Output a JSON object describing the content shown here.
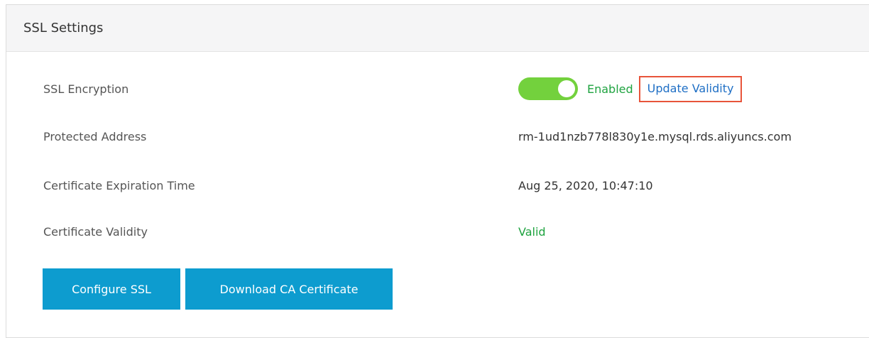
{
  "panel": {
    "title": "SSL Settings"
  },
  "rows": [
    {
      "label": "SSL Encryption"
    },
    {
      "label": "Protected Address",
      "value": "rm-1ud1nzb778l830y1e.mysql.rds.aliyuncs.com"
    },
    {
      "label": "Certificate Expiration Time",
      "value": "Aug 25, 2020, 10:47:10"
    },
    {
      "label": "Certificate Validity",
      "value": "Valid"
    }
  ],
  "ssl_encryption": {
    "status_text": "Enabled",
    "toggle_on": true,
    "update_link": "Update Validity"
  },
  "buttons": {
    "configure": "Configure SSL",
    "download": "Download CA Certificate"
  },
  "colors": {
    "toggle": "#73d13d",
    "success": "#1fa340",
    "link": "#1f6fc5",
    "highlight_border": "#e8543a",
    "primary_button": "#0d9ccf"
  }
}
